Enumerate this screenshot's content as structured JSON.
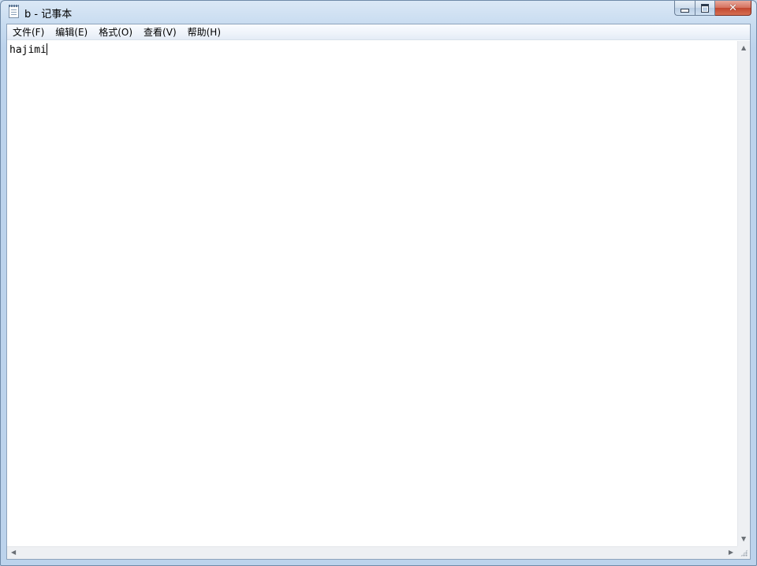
{
  "window": {
    "title": "b - 记事本",
    "icon": "notepad-icon",
    "controls": {
      "minimize_icon": "minimize-icon",
      "maximize_icon": "maximize-icon",
      "close_icon": "close-icon",
      "close_glyph": "✕"
    }
  },
  "menu": [
    {
      "label": "文件(F)"
    },
    {
      "label": "编辑(E)"
    },
    {
      "label": "格式(O)"
    },
    {
      "label": "查看(V)"
    },
    {
      "label": "帮助(H)"
    }
  ],
  "editor": {
    "content": "hajimi"
  },
  "scrollbars": {
    "up_glyph": "▲",
    "down_glyph": "▼",
    "left_glyph": "◀",
    "right_glyph": "▶"
  },
  "colors": {
    "close_button": "#c2462f",
    "frame": "#bcd3ec"
  }
}
